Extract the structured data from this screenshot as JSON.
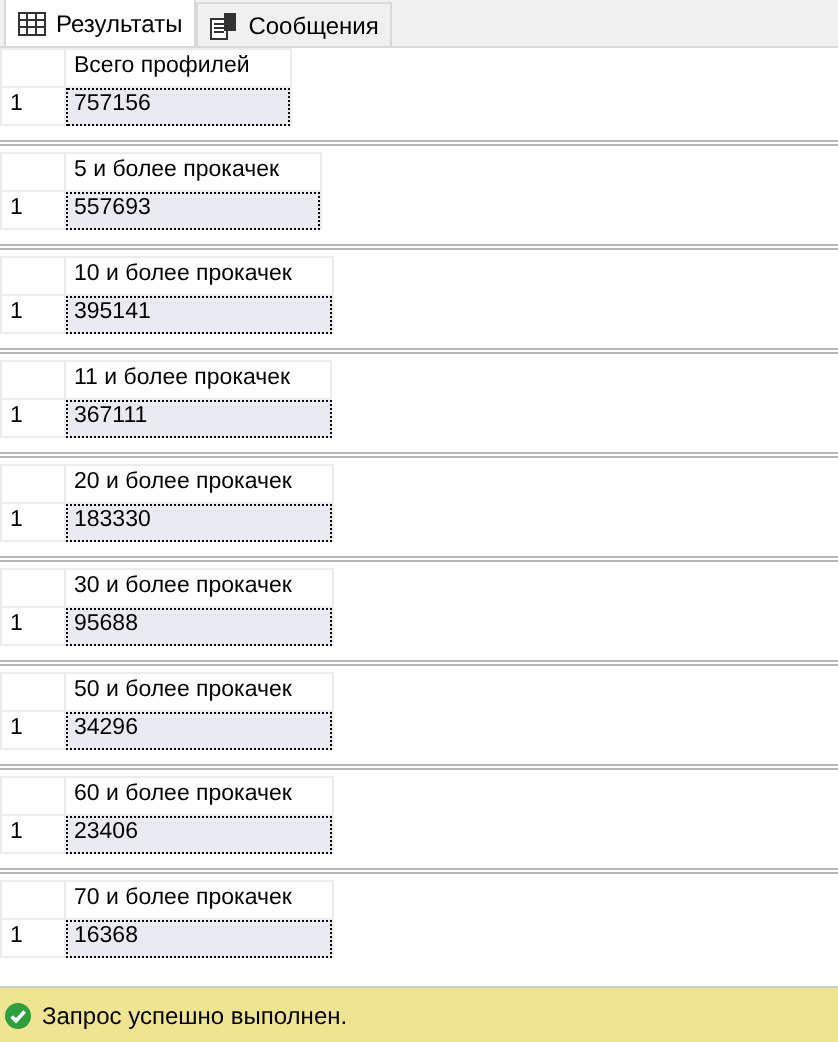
{
  "tabs": [
    {
      "label": "Результаты",
      "kind": "grid",
      "selected": true
    },
    {
      "label": "Сообщения",
      "kind": "messages",
      "selected": false
    }
  ],
  "result_sets": [
    {
      "column": "Всего профилей",
      "rows": [
        {
          "number": "1",
          "value": "757156"
        }
      ]
    },
    {
      "column": "5 и более прокачек",
      "rows": [
        {
          "number": "1",
          "value": "557693"
        }
      ]
    },
    {
      "column": "10 и более прокачек",
      "rows": [
        {
          "number": "1",
          "value": "395141"
        }
      ]
    },
    {
      "column": "11 и более прокачек",
      "rows": [
        {
          "number": "1",
          "value": "367111"
        }
      ]
    },
    {
      "column": "20 и более прокачек",
      "rows": [
        {
          "number": "1",
          "value": "183330"
        }
      ]
    },
    {
      "column": "30 и более прокачек",
      "rows": [
        {
          "number": "1",
          "value": "95688"
        }
      ]
    },
    {
      "column": "50 и более прокачек",
      "rows": [
        {
          "number": "1",
          "value": "34296"
        }
      ]
    },
    {
      "column": "60 и более прокачек",
      "rows": [
        {
          "number": "1",
          "value": "23406"
        }
      ]
    },
    {
      "column": "70 и более прокачек",
      "rows": [
        {
          "number": "1",
          "value": "16368"
        }
      ]
    }
  ],
  "status_bar": {
    "text": "Запрос успешно выполнен."
  }
}
